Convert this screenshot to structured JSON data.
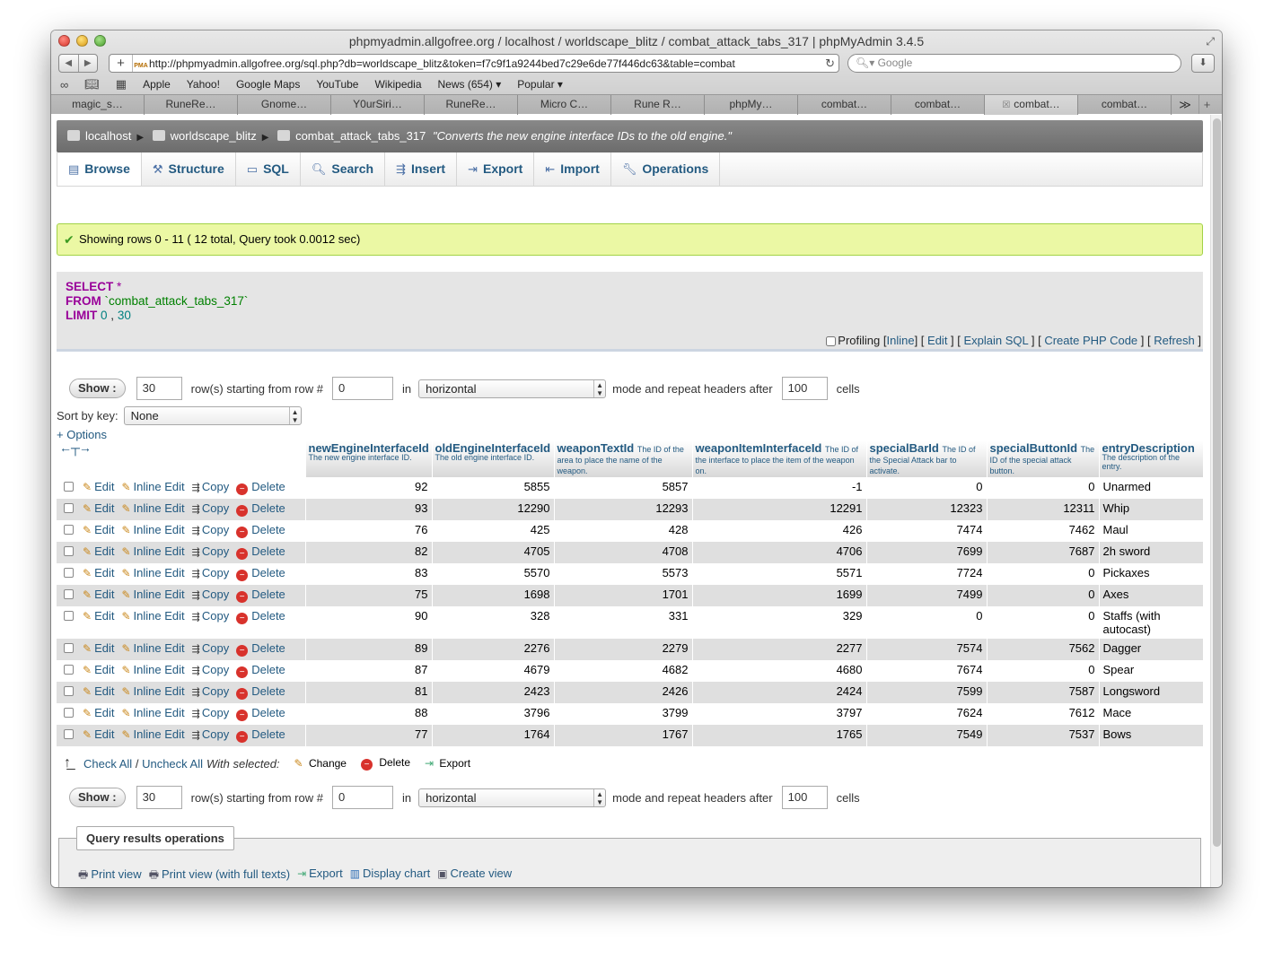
{
  "window": {
    "title": "phpmyadmin.allgofree.org / localhost / worldscape_blitz / combat_attack_tabs_317 | phpMyAdmin 3.4.5",
    "url": "http://phpmyadmin.allgofree.org/sql.php?db=worldscape_blitz&token=f7c9f1a9244bed7c29e6de77f446dc63&table=combat",
    "search_placeholder": "Google",
    "bookmarks": [
      "Apple",
      "Yahoo!",
      "Google Maps",
      "YouTube",
      "Wikipedia",
      "News (654) ▾",
      "Popular ▾"
    ],
    "tabs": [
      "magic_s…",
      "RuneRe…",
      "Gnome…",
      "Y0urSiri…",
      "RuneRe…",
      "Micro C…",
      "Rune R…",
      "phpMy…",
      "combat…",
      "combat…",
      "combat…",
      "combat…"
    ]
  },
  "breadcrumb": {
    "server": "localhost",
    "database": "worldscape_blitz",
    "table": "combat_attack_tabs_317",
    "comment": "\"Converts the new engine interface IDs to the old engine.\""
  },
  "menu": {
    "tabs": [
      "Browse",
      "Structure",
      "SQL",
      "Search",
      "Insert",
      "Export",
      "Import",
      "Operations"
    ]
  },
  "message": "Showing rows 0 - 11 ( 12 total, Query took 0.0012 sec)",
  "sql": {
    "select_kw": "SELECT",
    "star": "*",
    "from_kw": "FROM",
    "table": "`combat_attack_tabs_317`",
    "limit_kw": "LIMIT",
    "limit_a": "0",
    "comma": ",",
    "limit_b": "30",
    "ops": {
      "profiling": "Profiling",
      "inline": "Inline",
      "edit": "Edit",
      "explain": "Explain SQL",
      "create_php": "Create PHP Code",
      "refresh": "Refresh"
    }
  },
  "navigation": {
    "show_label": "Show :",
    "rows": "30",
    "starting_label": "row(s) starting from row #",
    "start": "0",
    "in_label": "in",
    "mode": "horizontal",
    "mode_label": "mode and repeat headers after",
    "repeat": "100",
    "cells_label": "cells"
  },
  "sort": {
    "label": "Sort by key:",
    "value": "None",
    "options_label": "+ Options"
  },
  "columns": [
    {
      "name": "newEngineInterfaceId",
      "comment": "The new engine interface ID."
    },
    {
      "name": "oldEngineInterfaceId",
      "comment": "The old engine interface ID."
    },
    {
      "name": "weaponTextId",
      "comment": "The ID of the area to place the name of the weapon."
    },
    {
      "name": "weaponItemInterfaceId",
      "comment": "The ID of the interface to place the item of the weapon on."
    },
    {
      "name": "specialBarId",
      "comment": "The ID of the Special Attack bar to activate."
    },
    {
      "name": "specialButtonId",
      "comment": "The ID of the special attack button."
    },
    {
      "name": "entryDescription",
      "comment": "The description of the entry."
    }
  ],
  "row_actions": {
    "edit": "Edit",
    "inline_edit": "Inline Edit",
    "copy": "Copy",
    "delete": "Delete"
  },
  "rows": [
    [
      "92",
      "5855",
      "5857",
      "-1",
      "0",
      "0",
      "Unarmed"
    ],
    [
      "93",
      "12290",
      "12293",
      "12291",
      "12323",
      "12311",
      "Whip"
    ],
    [
      "76",
      "425",
      "428",
      "426",
      "7474",
      "7462",
      "Maul"
    ],
    [
      "82",
      "4705",
      "4708",
      "4706",
      "7699",
      "7687",
      "2h sword"
    ],
    [
      "83",
      "5570",
      "5573",
      "5571",
      "7724",
      "0",
      "Pickaxes"
    ],
    [
      "75",
      "1698",
      "1701",
      "1699",
      "7499",
      "0",
      "Axes"
    ],
    [
      "90",
      "328",
      "331",
      "329",
      "0",
      "0",
      "Staffs (with autocast)"
    ],
    [
      "89",
      "2276",
      "2279",
      "2277",
      "7574",
      "7562",
      "Dagger"
    ],
    [
      "87",
      "4679",
      "4682",
      "4680",
      "7674",
      "0",
      "Spear"
    ],
    [
      "81",
      "2423",
      "2426",
      "2424",
      "7599",
      "7587",
      "Longsword"
    ],
    [
      "88",
      "3796",
      "3799",
      "3797",
      "7624",
      "7612",
      "Mace"
    ],
    [
      "77",
      "1764",
      "1767",
      "1765",
      "7549",
      "7537",
      "Bows"
    ]
  ],
  "with_selected": {
    "check_all": "Check All",
    "slash": "/",
    "uncheck_all": "Uncheck All",
    "label": "With selected:",
    "change": "Change",
    "delete": "Delete",
    "export": "Export"
  },
  "query_ops": {
    "legend": "Query results operations",
    "links": [
      "Print view",
      "Print view (with full texts)",
      "Export",
      "Display chart",
      "Create view"
    ]
  },
  "colors": {
    "link": "#235a81",
    "success_bg": "#ebf8a4",
    "sql_keyword": "#990099",
    "row_even": "#dfdfdf"
  }
}
